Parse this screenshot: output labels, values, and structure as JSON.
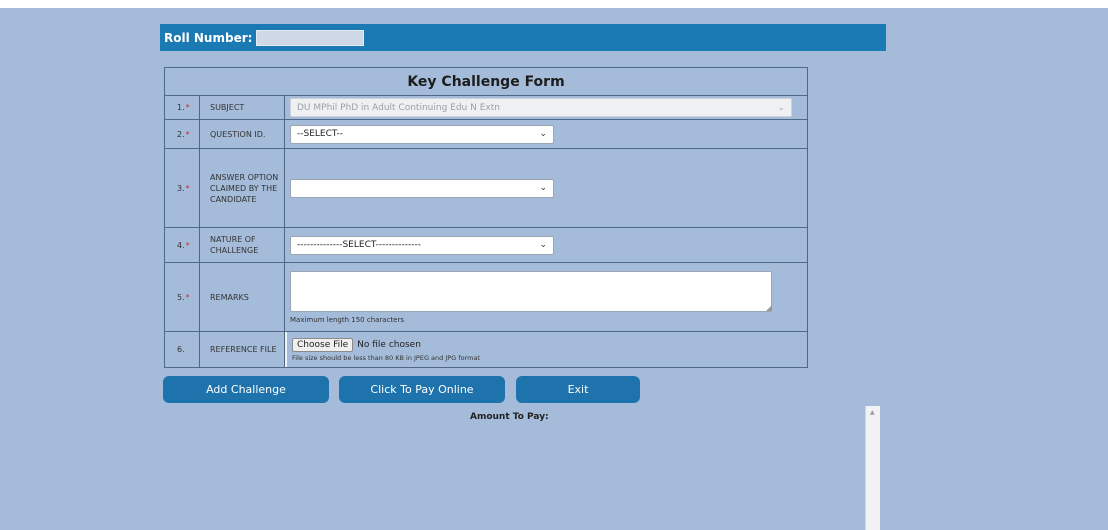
{
  "roll": {
    "label": "Roll Number:",
    "value": ""
  },
  "form": {
    "title": "Key Challenge Form",
    "rows": [
      {
        "num": "1.",
        "required": "*",
        "label": "SUBJECT",
        "value": "DU MPhil PhD in Adult Continuing Edu N Extn"
      },
      {
        "num": "2.",
        "required": "*",
        "label": "QUESTION ID.",
        "value": "--SELECT--"
      },
      {
        "num": "3.",
        "required": "*",
        "label": "ANSWER OPTION CLAIMED BY THE CANDIDATE",
        "value": ""
      },
      {
        "num": "4.",
        "required": "*",
        "label": "NATURE OF CHALLENGE",
        "value": "--------------SELECT--------------"
      },
      {
        "num": "5.",
        "required": "*",
        "label": "REMARKS",
        "value": "",
        "hint": "Maximum length 150 characters"
      },
      {
        "num": "6.",
        "required": "",
        "label": "REFERENCE FILE",
        "button": "Choose File",
        "status": "No file chosen",
        "hint": "File size should be less than 80 KB in JPEG and JPG format"
      }
    ]
  },
  "buttons": {
    "add": "Add Challenge",
    "pay": "Click To Pay Online",
    "exit": "Exit"
  },
  "amount": {
    "label": "Amount To Pay:"
  },
  "colors": {
    "page_bg": "#a4bcd9",
    "header_bg": "#1b79b3",
    "button_bg": "#1f73ad",
    "required_mark": "#d22222"
  },
  "icons": {
    "select_arrow": "chevron-down-icon",
    "scroll_up": "scroll-up-arrow-icon",
    "resize": "resize-grip-icon"
  }
}
